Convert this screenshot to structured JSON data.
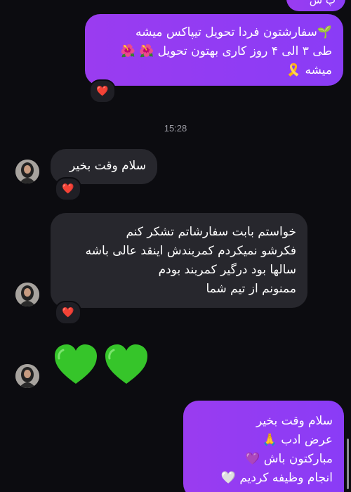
{
  "colors": {
    "background": "#0c0c10",
    "outgoing_bubble": "#9a3cf0",
    "incoming_bubble": "#27272d",
    "reaction_heart": "#ff3040",
    "green_heart": "#36c52a"
  },
  "top_partial_bubble": {
    "text": "پ ش"
  },
  "msg_out_1": {
    "lines": [
      "🌱سفارشتون فردا تحویل تیپاکس میشه",
      "طی ۳ الی ۴ روز کاری بهتون تحویل 🌺 🌺",
      "میشه 🎗️"
    ],
    "reaction": "❤️"
  },
  "timestamp": "15:28",
  "msg_in_1": {
    "text": "سلام وقت بخیر",
    "reaction": "❤️"
  },
  "msg_in_2": {
    "lines": [
      "خواستم بابت سفارشاتم تشکر کنم",
      "فکرشو نمیکردم کمربندش اینقد عالی باشه",
      "سالها بود درگیر کمربند بودم",
      "ممنونم از تیم شما"
    ],
    "reaction": "❤️"
  },
  "msg_in_3": {
    "emoji": "💚💚",
    "icon": "green-heart-icon"
  },
  "msg_out_2": {
    "lines": [
      "سلام وقت بخیر",
      "عرض ادب 🙏",
      "مبارکتون باش 💜",
      "انجام وظیفه کردیم 🤍"
    ]
  }
}
